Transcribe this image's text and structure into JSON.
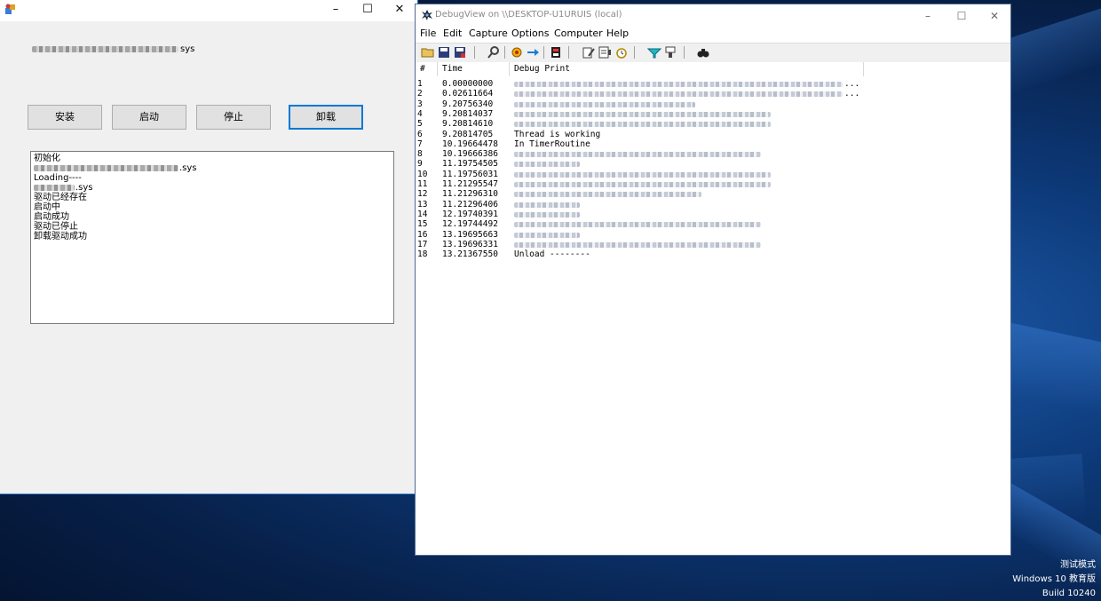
{
  "desktop": {
    "watermark": {
      "line1": "测试模式",
      "line2": "Windows 10 教育版",
      "line3": "Build 10240"
    }
  },
  "app_window": {
    "controls": {
      "minimize": "–",
      "maximize": "☐",
      "close": "✕"
    },
    "driver_label_suffix": "sys",
    "buttons": {
      "install": "安装",
      "start": "启动",
      "stop": "停止",
      "uninstall": "卸载"
    },
    "log": [
      {
        "text": "初始化"
      },
      {
        "text": ".sys",
        "blurred": true
      },
      {
        "text": "Loading----"
      },
      {
        "text": ".sys",
        "blurred": true
      },
      {
        "text": "驱动已经存在"
      },
      {
        "text": "启动中"
      },
      {
        "text": "启动成功"
      },
      {
        "text": "驱动已停止"
      },
      {
        "text": "卸载驱动成功"
      }
    ]
  },
  "debugview": {
    "title": "DebugView on \\\\DESKTOP-U1URUIS (local)",
    "controls": {
      "minimize": "–",
      "maximize": "☐",
      "close": "✕"
    },
    "menu": [
      "File",
      "Edit",
      "Capture",
      "Options",
      "Computer",
      "Help"
    ],
    "columns": [
      "#",
      "Time",
      "Debug Print"
    ],
    "rows": [
      {
        "n": "1",
        "time": "0.00000000",
        "print": "...",
        "blurred": true
      },
      {
        "n": "2",
        "time": "0.02611664",
        "print": "...",
        "blurred": true
      },
      {
        "n": "3",
        "time": "9.20756340",
        "print": "",
        "blurred": true
      },
      {
        "n": "4",
        "time": "9.20814037",
        "print": "",
        "blurred": true
      },
      {
        "n": "5",
        "time": "9.20814610",
        "print": "",
        "blurred": true
      },
      {
        "n": "6",
        "time": "9.20814705",
        "print": "Thread is working",
        "blurred": false
      },
      {
        "n": "7",
        "time": "10.19664478",
        "print": "In TimerRoutine",
        "blurred": false
      },
      {
        "n": "8",
        "time": "10.19666386",
        "print": "",
        "blurred": true
      },
      {
        "n": "9",
        "time": "11.19754505",
        "print": "",
        "blurred": true
      },
      {
        "n": "10",
        "time": "11.19756031",
        "print": "",
        "blurred": true
      },
      {
        "n": "11",
        "time": "11.21295547",
        "print": "",
        "blurred": true
      },
      {
        "n": "12",
        "time": "11.21296310",
        "print": "",
        "blurred": true
      },
      {
        "n": "13",
        "time": "11.21296406",
        "print": "",
        "blurred": true
      },
      {
        "n": "14",
        "time": "12.19740391",
        "print": "",
        "blurred": true
      },
      {
        "n": "15",
        "time": "12.19744492",
        "print": "",
        "blurred": true
      },
      {
        "n": "16",
        "time": "13.19695663",
        "print": "",
        "blurred": true
      },
      {
        "n": "17",
        "time": "13.19696331",
        "print": "",
        "blurred": true
      },
      {
        "n": "18",
        "time": "13.21367550",
        "print": "Unload --------",
        "blurred": false
      }
    ]
  }
}
